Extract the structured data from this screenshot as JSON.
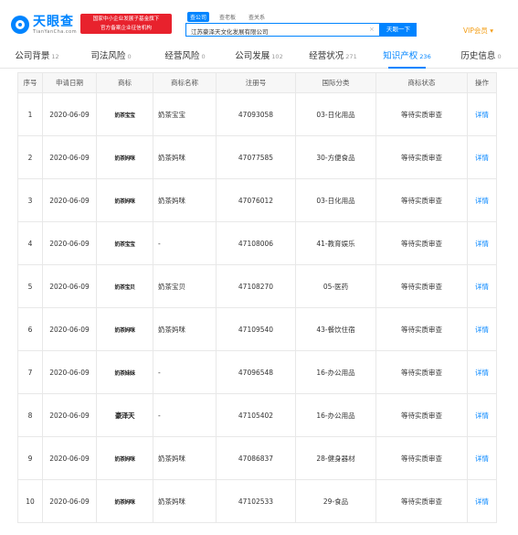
{
  "header": {
    "logo_cn": "天眼查",
    "logo_en": "TianYanCha.com",
    "badge_line1": "国家中小企业发展子基金旗下",
    "badge_line2": "官方备案企业征信机构",
    "search_tabs": [
      "查公司",
      "查老板",
      "查关系"
    ],
    "search_value": "江苏豪泽天文化发展有限公司",
    "search_clear": "×",
    "search_button": "天眼一下",
    "vip_label": "VIP会员 ▾"
  },
  "nav": [
    {
      "label": "公司背景",
      "count": "12"
    },
    {
      "label": "司法风险",
      "count": "0"
    },
    {
      "label": "经营风险",
      "count": "0"
    },
    {
      "label": "公司发展",
      "count": "102"
    },
    {
      "label": "经营状况",
      "count": "271"
    },
    {
      "label": "知识产权",
      "count": "236"
    },
    {
      "label": "历史信息",
      "count": "0"
    }
  ],
  "table": {
    "headers": [
      "序号",
      "申请日期",
      "商标",
      "商标名称",
      "注册号",
      "国际分类",
      "商标状态",
      "操作"
    ],
    "rows": [
      {
        "no": "1",
        "date": "2020-06-09",
        "mark": "奶茶宝宝",
        "name": "奶茶宝宝",
        "reg": "47093058",
        "cls": "03-日化用品",
        "status": "等待实质审查",
        "op": "详情"
      },
      {
        "no": "2",
        "date": "2020-06-09",
        "mark": "奶茶妈咪",
        "name": "奶茶妈咪",
        "reg": "47077585",
        "cls": "30-方便食品",
        "status": "等待实质审查",
        "op": "详情"
      },
      {
        "no": "3",
        "date": "2020-06-09",
        "mark": "奶茶妈咪",
        "name": "奶茶妈咪",
        "reg": "47076012",
        "cls": "03-日化用品",
        "status": "等待实质审查",
        "op": "详情"
      },
      {
        "no": "4",
        "date": "2020-06-09",
        "mark": "奶茶宝宝",
        "name": "-",
        "reg": "47108006",
        "cls": "41-教育娱乐",
        "status": "等待实质审查",
        "op": "详情"
      },
      {
        "no": "5",
        "date": "2020-06-09",
        "mark": "奶茶宝贝",
        "name": "奶茶宝贝",
        "reg": "47108270",
        "cls": "05-医药",
        "status": "等待实质审查",
        "op": "详情"
      },
      {
        "no": "6",
        "date": "2020-06-09",
        "mark": "奶茶妈咪",
        "name": "奶茶妈咪",
        "reg": "47109540",
        "cls": "43-餐饮住宿",
        "status": "等待实质审查",
        "op": "详情"
      },
      {
        "no": "7",
        "date": "2020-06-09",
        "mark": "奶茶妹妹",
        "name": "-",
        "reg": "47096548",
        "cls": "16-办公用品",
        "status": "等待实质审查",
        "op": "详情"
      },
      {
        "no": "8",
        "date": "2020-06-09",
        "mark": "豪泽天",
        "name": "-",
        "reg": "47105402",
        "cls": "16-办公用品",
        "status": "等待实质审查",
        "op": "详情"
      },
      {
        "no": "9",
        "date": "2020-06-09",
        "mark": "奶茶妈咪",
        "name": "奶茶妈咪",
        "reg": "47086837",
        "cls": "28-健身器材",
        "status": "等待实质审查",
        "op": "详情"
      },
      {
        "no": "10",
        "date": "2020-06-09",
        "mark": "奶茶妈咪",
        "name": "奶茶妈咪",
        "reg": "47102533",
        "cls": "29-食品",
        "status": "等待实质审查",
        "op": "详情"
      }
    ]
  },
  "colors": {
    "brand": "#0084ff",
    "badge": "#e8222d",
    "vip": "#f39c12"
  },
  "icons": {
    "logo": "tianyancha-logo-icon"
  }
}
